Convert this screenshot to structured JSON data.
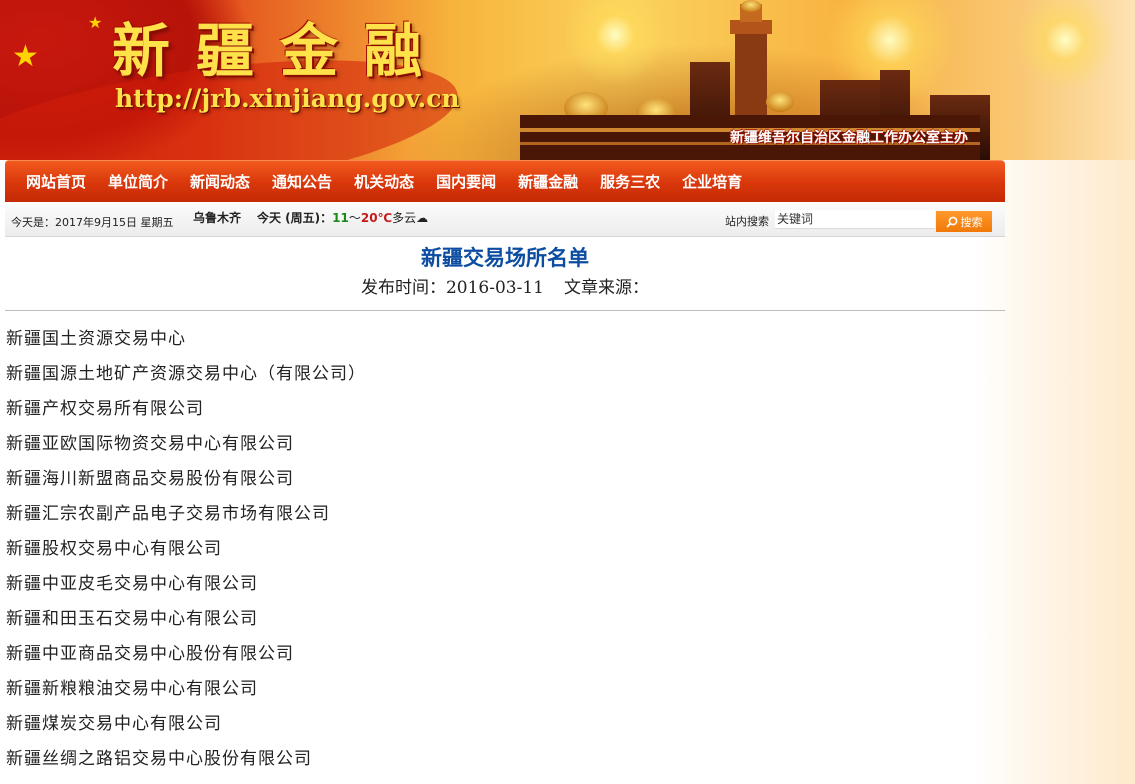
{
  "header": {
    "site_title": "新疆金融",
    "site_url": "http://jrb.xinjiang.gov.cn",
    "host_org": "新疆维吾尔自治区金融工作办公室主办"
  },
  "nav": {
    "items": [
      "网站首页",
      "单位简介",
      "新闻动态",
      "通知公告",
      "机关动态",
      "国内要闻",
      "新疆金融",
      "服务三农",
      "企业培育"
    ]
  },
  "infobar": {
    "today": "今天是：2017年9月15日 星期五",
    "city": "乌鲁木齐",
    "weather_label": "今天 (周五)：",
    "temp_low": "11",
    "temp_sep": "～",
    "temp_high": "20℃",
    "condition": "多云",
    "search_label": "站内搜索",
    "search_placeholder": "关键词",
    "search_button": "搜索"
  },
  "article": {
    "title": "新疆交易场所名单",
    "publish_label": "发布时间：",
    "publish_date": "2016-03-11",
    "source_label": "文章来源："
  },
  "list": [
    "新疆国土资源交易中心",
    "新疆国源土地矿产资源交易中心（有限公司）",
    "新疆产权交易所有限公司",
    "新疆亚欧国际物资交易中心有限公司",
    "新疆海川新盟商品交易股份有限公司",
    "新疆汇宗农副产品电子交易市场有限公司",
    "新疆股权交易中心有限公司",
    "新疆中亚皮毛交易中心有限公司",
    "新疆和田玉石交易中心有限公司",
    "新疆中亚商品交易中心股份有限公司",
    "新疆新粮粮油交易中心有限公司",
    "新疆煤炭交易中心有限公司",
    "新疆丝绸之路铝交易中心股份有限公司"
  ],
  "colors": {
    "nav_bg": "#d9370b",
    "title_blue": "#0d4da1",
    "banner_gold": "#ffe14a",
    "search_btn": "#f07808"
  }
}
